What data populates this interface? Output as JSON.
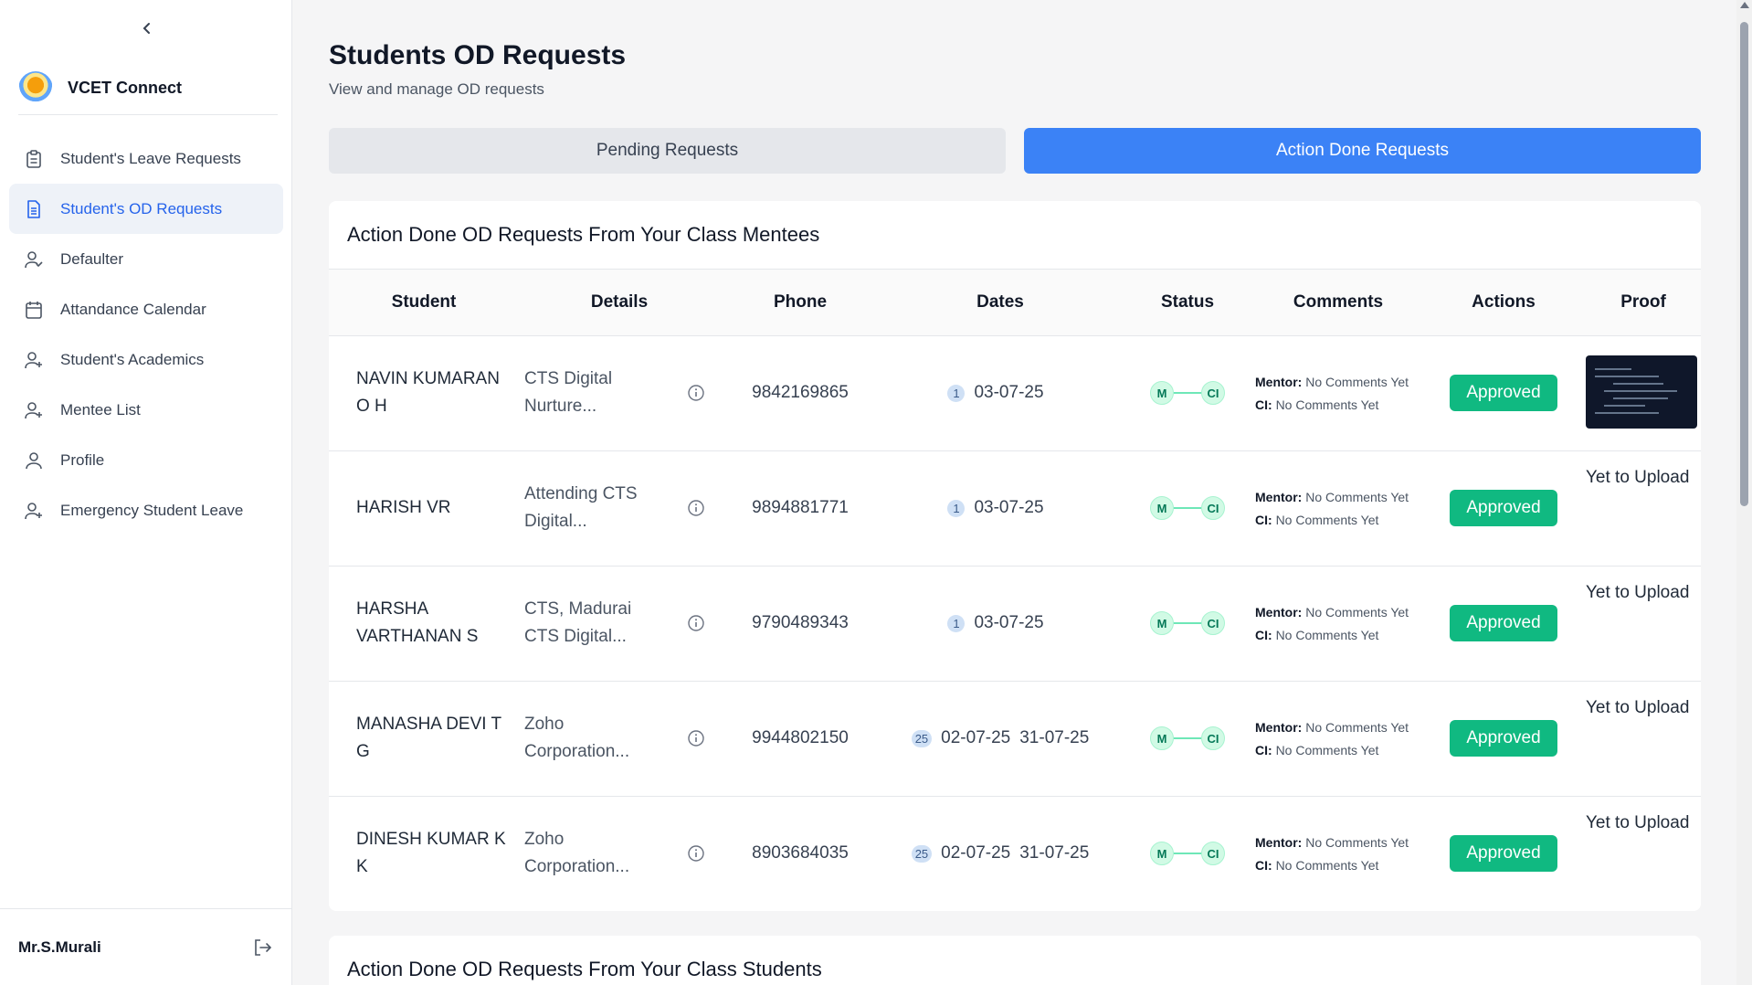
{
  "app": {
    "name": "VCET Connect"
  },
  "sidebar": {
    "items": [
      {
        "label": "Student's Leave Requests",
        "icon": "clipboard-icon",
        "active": false
      },
      {
        "label": "Student's OD Requests",
        "icon": "document-icon",
        "active": true
      },
      {
        "label": "Defaulter",
        "icon": "user-check-icon",
        "active": false
      },
      {
        "label": "Attandance Calendar",
        "icon": "calendar-icon",
        "active": false
      },
      {
        "label": "Student's Academics",
        "icon": "user-plus-icon",
        "active": false
      },
      {
        "label": "Mentee List",
        "icon": "user-plus-icon",
        "active": false
      },
      {
        "label": "Profile",
        "icon": "user-icon",
        "active": false
      },
      {
        "label": "Emergency Student Leave",
        "icon": "user-plus-icon",
        "active": false
      }
    ],
    "user": "Mr.S.Murali"
  },
  "page": {
    "title": "Students OD Requests",
    "subtitle": "View and manage OD requests"
  },
  "tabs": [
    {
      "label": "Pending Requests",
      "active": false
    },
    {
      "label": "Action Done Requests",
      "active": true
    }
  ],
  "section1": {
    "title": "Action Done OD Requests From Your Class Mentees",
    "columns": [
      "Student",
      "Details",
      "Phone",
      "Dates",
      "Status",
      "Comments",
      "Actions",
      "Proof"
    ],
    "rows": [
      {
        "student": "NAVIN KUMARAN O H",
        "details": "CTS Digital Nurture...",
        "phone": "9842169865",
        "days": "1",
        "start": "03-07-25",
        "end": "",
        "status_m": "M",
        "status_ci": "CI",
        "mentor_label": "Mentor:",
        "mentor_comment": "No Comments Yet",
        "ci_label": "CI:",
        "ci_comment": "No Comments Yet",
        "action": "Approved",
        "proof": ""
      },
      {
        "student": "HARISH VR",
        "details": "Attending CTS Digital...",
        "phone": "9894881771",
        "days": "1",
        "start": "03-07-25",
        "end": "",
        "status_m": "M",
        "status_ci": "CI",
        "mentor_label": "Mentor:",
        "mentor_comment": "No Comments Yet",
        "ci_label": "CI:",
        "ci_comment": "No Comments Yet",
        "action": "Approved",
        "proof": "Yet to Upload"
      },
      {
        "student": "HARSHA VARTHANAN S",
        "details": "CTS, Madurai CTS Digital...",
        "phone": "9790489343",
        "days": "1",
        "start": "03-07-25",
        "end": "",
        "status_m": "M",
        "status_ci": "CI",
        "mentor_label": "Mentor:",
        "mentor_comment": "No Comments Yet",
        "ci_label": "CI:",
        "ci_comment": "No Comments Yet",
        "action": "Approved",
        "proof": "Yet to Upload"
      },
      {
        "student": "MANASHA DEVI T G",
        "details": "Zoho Corporation...",
        "phone": "9944802150",
        "days": "25",
        "start": "02-07-25",
        "end": "31-07-25",
        "status_m": "M",
        "status_ci": "CI",
        "mentor_label": "Mentor:",
        "mentor_comment": "No Comments Yet",
        "ci_label": "CI:",
        "ci_comment": "No Comments Yet",
        "action": "Approved",
        "proof": "Yet to Upload"
      },
      {
        "student": "DINESH KUMAR K K",
        "details": "Zoho Corporation...",
        "phone": "8903684035",
        "days": "25",
        "start": "02-07-25",
        "end": "31-07-25",
        "status_m": "M",
        "status_ci": "CI",
        "mentor_label": "Mentor:",
        "mentor_comment": "No Comments Yet",
        "ci_label": "CI:",
        "ci_comment": "No Comments Yet",
        "action": "Approved",
        "proof": "Yet to Upload"
      }
    ]
  },
  "section2": {
    "title": "Action Done OD Requests From Your Class Students"
  },
  "colors": {
    "accent": "#3b82f6",
    "approved": "#10b981",
    "active_nav_bg": "#eef2f8"
  }
}
